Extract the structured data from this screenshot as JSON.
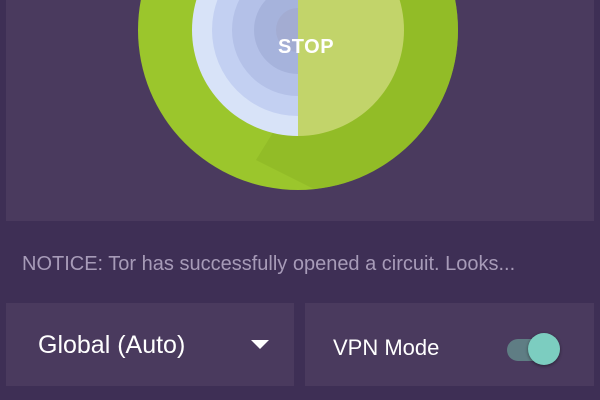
{
  "main_button": {
    "label": "STOP"
  },
  "notice": {
    "text": "NOTICE: Tor has successfully opened a circuit. Looks..."
  },
  "country_selector": {
    "selected": "Global (Auto)"
  },
  "vpn": {
    "label": "VPN Mode",
    "enabled": true
  },
  "colors": {
    "background": "#3e2f55",
    "panel": "#4a3a5e",
    "onion_green": "#9bc62c",
    "onion_inner_green": "#c2d46a",
    "onion_blue": "#d8e3f8",
    "toggle_thumb": "#7ccdc0",
    "toggle_track": "#5f7d84",
    "notice_text": "#a79bb8"
  },
  "icons": {
    "onion": "tor-onion-icon",
    "dropdown": "chevron-down-icon"
  }
}
